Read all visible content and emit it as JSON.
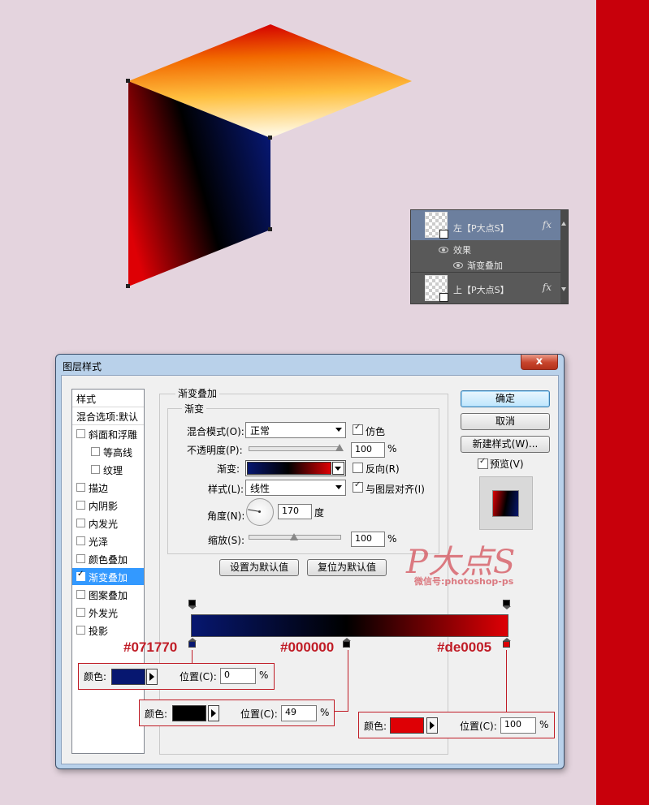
{
  "layers_panel": {
    "layer_top": {
      "name": "左【P大点S】",
      "fx": "fx"
    },
    "effects_label": "效果",
    "effect_item": "渐变叠加",
    "layer_bottom": {
      "name": "上【P大点S】",
      "fx": "fx"
    }
  },
  "dialog": {
    "title": "图层样式",
    "close": "x",
    "style_list": {
      "header": "样式",
      "blend": "混合选项:默认",
      "items": [
        {
          "label": "斜面和浮雕",
          "checked": false
        },
        {
          "label": "等高线",
          "checked": false
        },
        {
          "label": "纹理",
          "checked": false
        },
        {
          "label": "描边",
          "checked": false
        },
        {
          "label": "内阴影",
          "checked": false
        },
        {
          "label": "内发光",
          "checked": false
        },
        {
          "label": "光泽",
          "checked": false
        },
        {
          "label": "颜色叠加",
          "checked": false
        },
        {
          "label": "渐变叠加",
          "checked": true,
          "selected": true
        },
        {
          "label": "图案叠加",
          "checked": false
        },
        {
          "label": "外发光",
          "checked": false
        },
        {
          "label": "投影",
          "checked": false
        }
      ]
    },
    "panel": {
      "section_title": "渐变叠加",
      "group_title": "渐变",
      "blend_mode": {
        "label": "混合模式(O):",
        "value": "正常"
      },
      "dither": {
        "label": "仿色",
        "checked": true
      },
      "opacity": {
        "label": "不透明度(P):",
        "value": "100",
        "unit": "%",
        "level": 1.0
      },
      "gradient": {
        "label": "渐变:"
      },
      "reverse": {
        "label": "反向(R)",
        "checked": false
      },
      "style": {
        "label": "样式(L):",
        "value": "线性"
      },
      "align": {
        "label": "与图层对齐(I)",
        "checked": true
      },
      "angle": {
        "label": "角度(N):",
        "value": "170",
        "unit": "度"
      },
      "scale": {
        "label": "缩放(S):",
        "value": "100",
        "unit": "%",
        "level": 0.5
      },
      "set_default": "设置为默认值",
      "reset_default": "复位为默认值"
    },
    "buttons": {
      "ok": "确定",
      "cancel": "取消",
      "new_style": "新建样式(W)...",
      "preview": {
        "label": "预览(V)",
        "checked": true
      }
    }
  },
  "gradient_editor": {
    "colors": [
      "#071770",
      "#000000",
      "#de0005"
    ],
    "stops": [
      {
        "hex_label": "#071770",
        "color": "#071770",
        "color_label": "颜色:",
        "position_label": "位置(C):",
        "position": "0",
        "unit": "%"
      },
      {
        "hex_label": "#000000",
        "color": "#000000",
        "color_label": "颜色:",
        "position_label": "位置(C):",
        "position": "49",
        "unit": "%"
      },
      {
        "hex_label": "#de0005",
        "color": "#de0005",
        "color_label": "颜色:",
        "position_label": "位置(C):",
        "position": "100",
        "unit": "%"
      }
    ]
  },
  "watermark": {
    "logo": "P大点S",
    "sub": "微信号:photoshop-ps"
  }
}
